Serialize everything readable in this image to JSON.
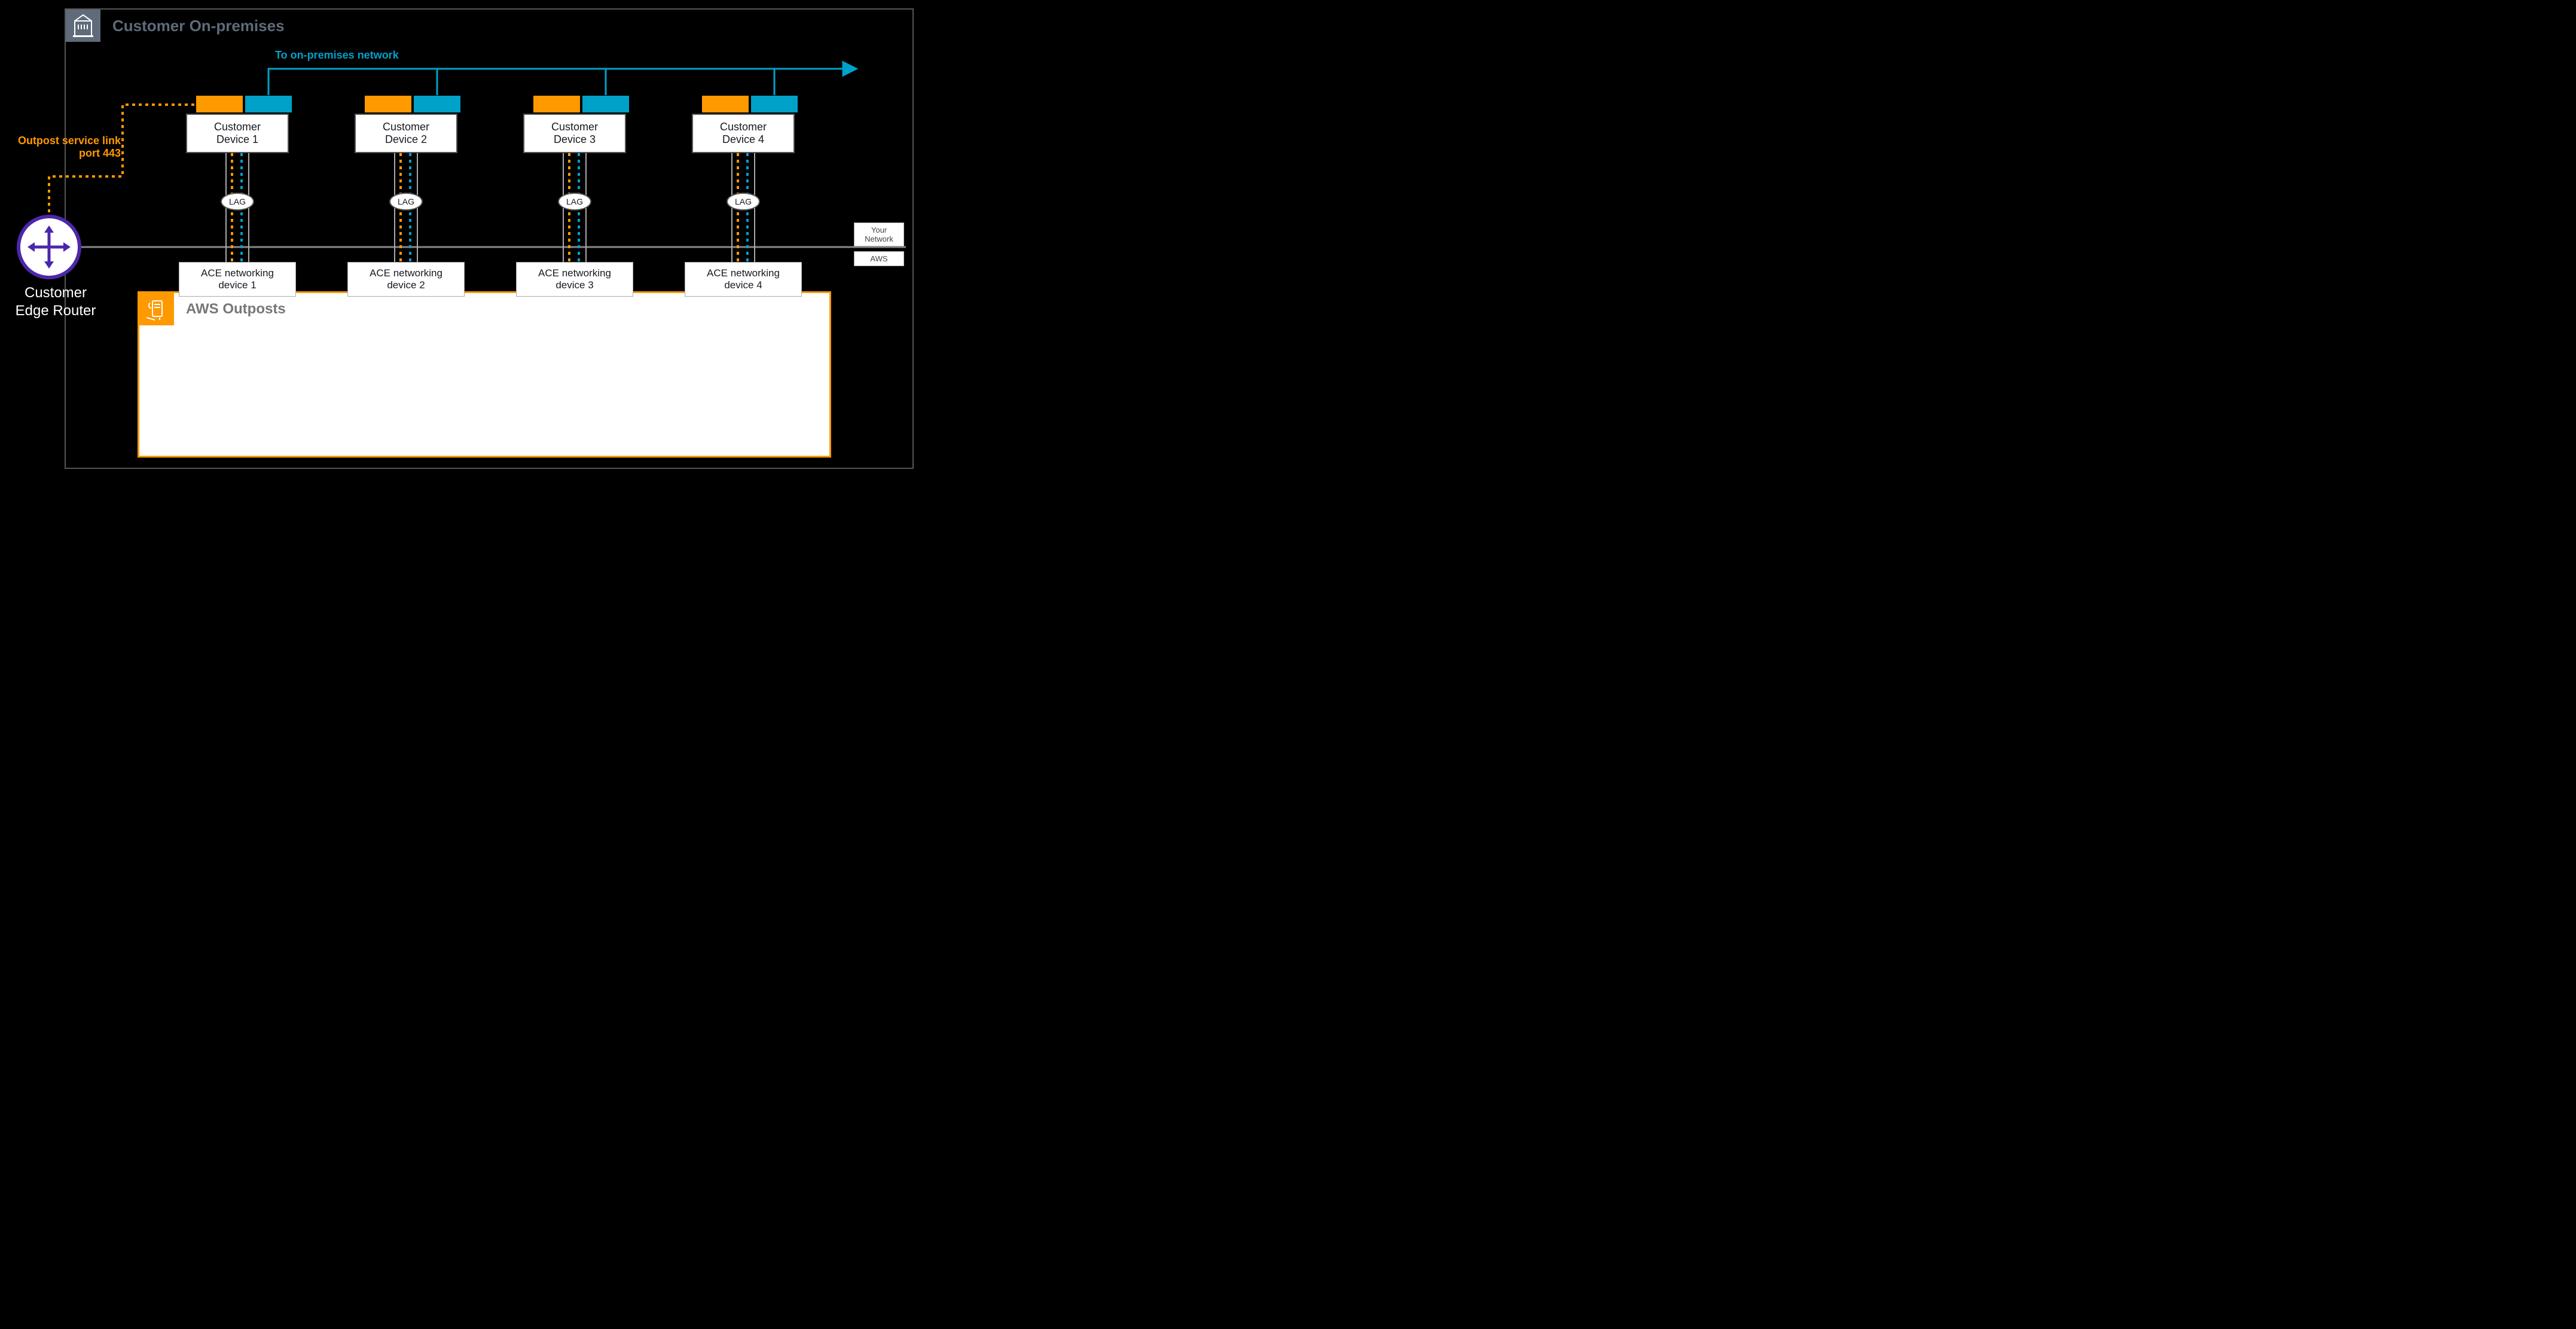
{
  "header": {
    "title": "Customer On-premises"
  },
  "labels": {
    "onprem_link": "To on-premises network",
    "service_link_line1": "Outpost service link",
    "service_link_line2": "port 443",
    "router_line1": "Customer",
    "router_line2": "Edge Router",
    "lag": "LAG",
    "your_network": "Your Network",
    "aws": "AWS"
  },
  "devices": {
    "customer": [
      {
        "line1": "Customer",
        "line2": "Device 1"
      },
      {
        "line1": "Customer",
        "line2": "Device 2"
      },
      {
        "line1": "Customer",
        "line2": "Device 3"
      },
      {
        "line1": "Customer",
        "line2": "Device 4"
      }
    ],
    "ace": [
      {
        "line1": "ACE networking",
        "line2": "device 1"
      },
      {
        "line1": "ACE networking",
        "line2": "device 2"
      },
      {
        "line1": "ACE networking",
        "line2": "device 3"
      },
      {
        "line1": "ACE networking",
        "line2": "device 4"
      }
    ]
  },
  "outposts": {
    "title": "AWS Outposts"
  },
  "colors": {
    "orange": "#ff9900",
    "blue": "#00a1c9",
    "purple": "#4d27aa",
    "gray": "#5f6b7a"
  }
}
